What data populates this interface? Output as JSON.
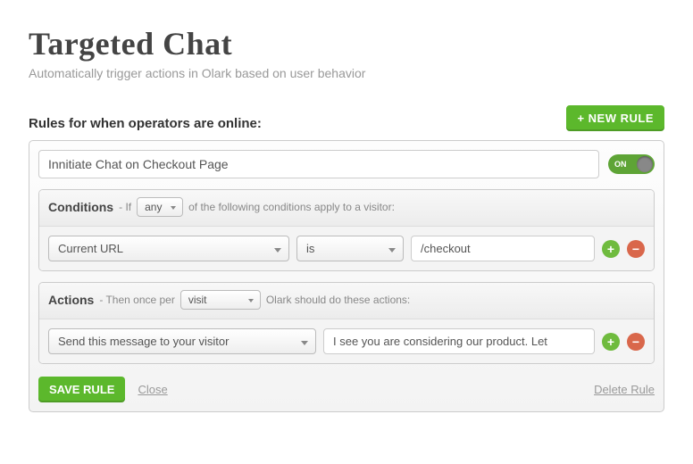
{
  "page": {
    "title": "Targeted Chat",
    "subtitle": "Automatically trigger actions in Olark based on user behavior"
  },
  "section": {
    "header": "Rules for when operators are online:",
    "new_rule_button": "+ NEW RULE"
  },
  "rule": {
    "title_value": "Innitiate Chat on Checkout Page",
    "toggle": {
      "state": "ON"
    },
    "conditions": {
      "label": "Conditions",
      "prefix": "- If",
      "match_type": "any",
      "suffix": "of the following conditions apply to a visitor:",
      "rows": [
        {
          "field": "Current URL",
          "operator": "is",
          "value": "/checkout"
        }
      ]
    },
    "actions": {
      "label": "Actions",
      "prefix": "- Then once per",
      "per": "visit",
      "suffix": "Olark should do these actions:",
      "rows": [
        {
          "action": "Send this message to your visitor",
          "value": "I see you are considering our product. Let"
        }
      ]
    },
    "footer": {
      "save": "SAVE RULE",
      "close": "Close",
      "delete": "Delete Rule"
    }
  }
}
